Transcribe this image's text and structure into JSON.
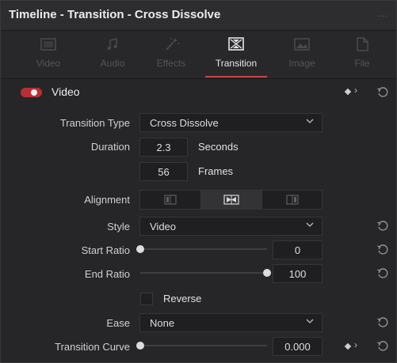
{
  "window": {
    "title": "Timeline - Transition - Cross Dissolve",
    "more_label": "..."
  },
  "tabs": [
    {
      "label": "Video",
      "icon": "video-frame-icon",
      "active": false
    },
    {
      "label": "Audio",
      "icon": "music-note-icon",
      "active": false
    },
    {
      "label": "Effects",
      "icon": "magic-wand-icon",
      "active": false
    },
    {
      "label": "Transition",
      "icon": "transition-icon",
      "active": true
    },
    {
      "label": "Image",
      "icon": "image-icon",
      "active": false
    },
    {
      "label": "File",
      "icon": "file-icon",
      "active": false
    }
  ],
  "section": {
    "title": "Video",
    "enabled": true
  },
  "fields": {
    "transition_type": {
      "label": "Transition Type",
      "value": "Cross Dissolve"
    },
    "duration": {
      "label": "Duration",
      "seconds": "2.3",
      "seconds_unit": "Seconds",
      "frames": "56",
      "frames_unit": "Frames"
    },
    "alignment": {
      "label": "Alignment",
      "options": [
        "align-start-icon",
        "align-center-icon",
        "align-end-icon"
      ],
      "selected": 1
    },
    "style": {
      "label": "Style",
      "value": "Video"
    },
    "start_ratio": {
      "label": "Start Ratio",
      "value": "0",
      "level": 0
    },
    "end_ratio": {
      "label": "End Ratio",
      "value": "100",
      "level": 1
    },
    "reverse": {
      "label": "Reverse",
      "checked": false
    },
    "ease": {
      "label": "Ease",
      "value": "None"
    },
    "transition_curve": {
      "label": "Transition Curve",
      "value": "0.000",
      "level": 0
    }
  },
  "colors": {
    "accent": "#c8444a",
    "toggle_on": "#b82f35",
    "panel_bg": "#262628",
    "field_bg": "#1f1f21"
  }
}
